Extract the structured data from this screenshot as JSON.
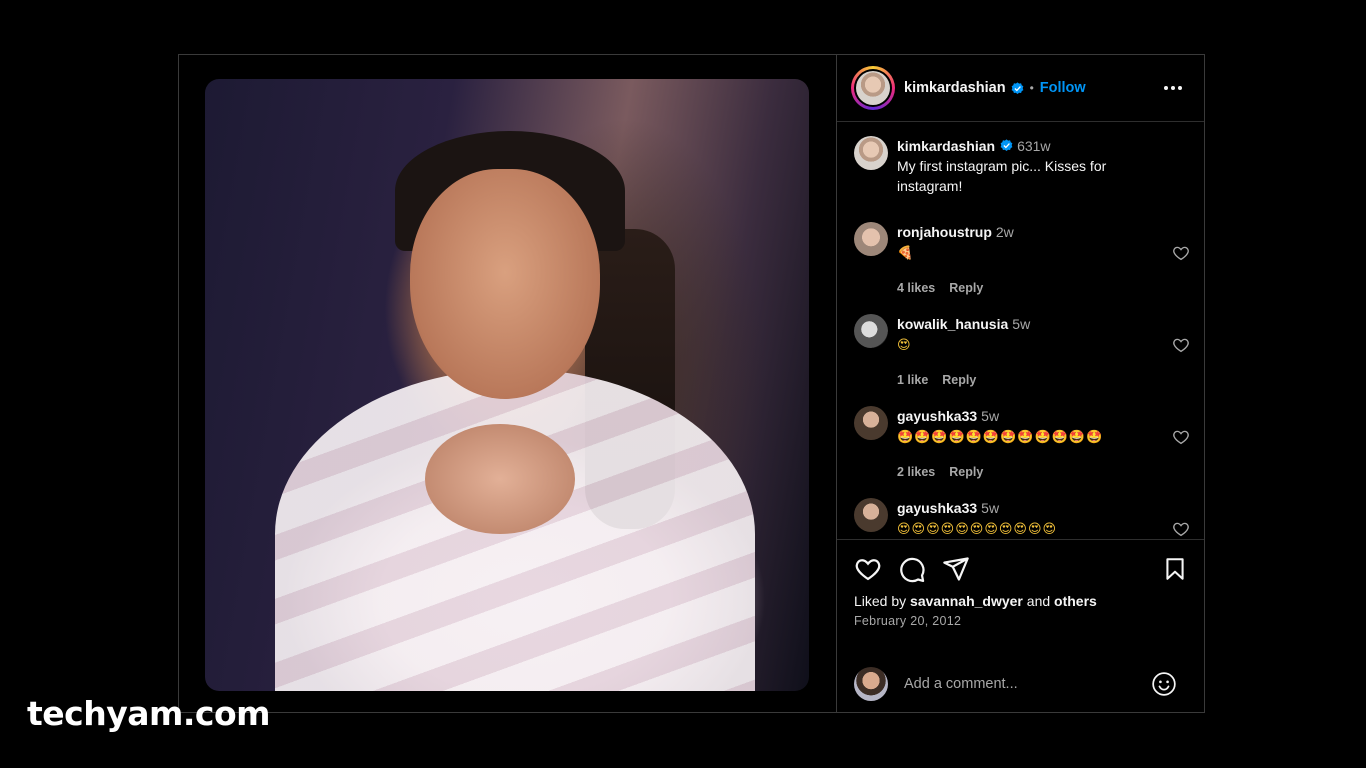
{
  "post": {
    "author": "kimkardashian",
    "follow_label": "Follow",
    "separator": "•",
    "caption": {
      "username": "kimkardashian",
      "time": "631w",
      "text": "My first instagram pic... Kisses for instagram!"
    },
    "comments": [
      {
        "username": "ronjahoustrup",
        "time": "2w",
        "text": "🍕",
        "likes": "4 likes",
        "reply": "Reply"
      },
      {
        "username": "kowalik_hanusia",
        "time": "5w",
        "text": "😍",
        "likes": "1 like",
        "reply": "Reply"
      },
      {
        "username": "gayushka33",
        "time": "5w",
        "text": "🤩🤩🤩🤩🤩🤩🤩🤩🤩🤩🤩🤩",
        "likes": "2 likes",
        "reply": "Reply"
      },
      {
        "username": "gayushka33",
        "time": "5w",
        "text": "😍😍😍😍😍😍😍😍😍😍😍"
      }
    ],
    "liked_by": {
      "prefix": "Liked by",
      "user": "savannah_dwyer",
      "conj": "and",
      "others": "others"
    },
    "date": "February 20, 2012",
    "add_comment_placeholder": "Add a comment..."
  },
  "icons": {
    "verified": "verified-badge-icon",
    "more": "more-options-icon",
    "like": "heart-icon",
    "comment": "comment-icon",
    "share": "share-icon",
    "save": "bookmark-icon",
    "emoji": "emoji-icon"
  },
  "colors": {
    "follow": "#0095f6",
    "verified": "#0095f6",
    "background": "#000000"
  },
  "watermark": "techyam.com"
}
